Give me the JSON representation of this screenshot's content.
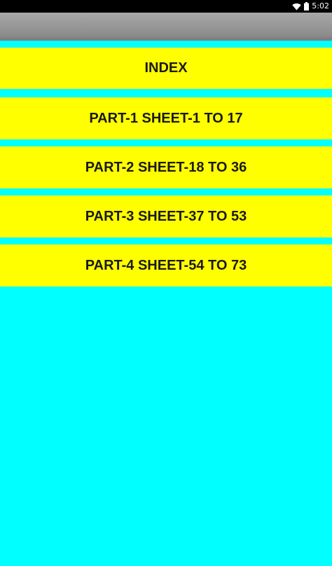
{
  "status_bar": {
    "time": "5:02",
    "icons": [
      "wifi-icon",
      "battery-icon"
    ]
  },
  "colors": {
    "background": "#00FFFF",
    "button": "#FFFF00",
    "button_text": "#1a1a1a",
    "action_bar": "#8c8c8c",
    "status_bar": "#000000"
  },
  "menu": {
    "items": [
      {
        "label": "INDEX"
      },
      {
        "label": "PART-1 SHEET-1 TO 17"
      },
      {
        "label": "PART-2 SHEET-18 TO 36"
      },
      {
        "label": "PART-3 SHEET-37 TO 53"
      },
      {
        "label": "PART-4 SHEET-54 TO 73"
      }
    ]
  }
}
